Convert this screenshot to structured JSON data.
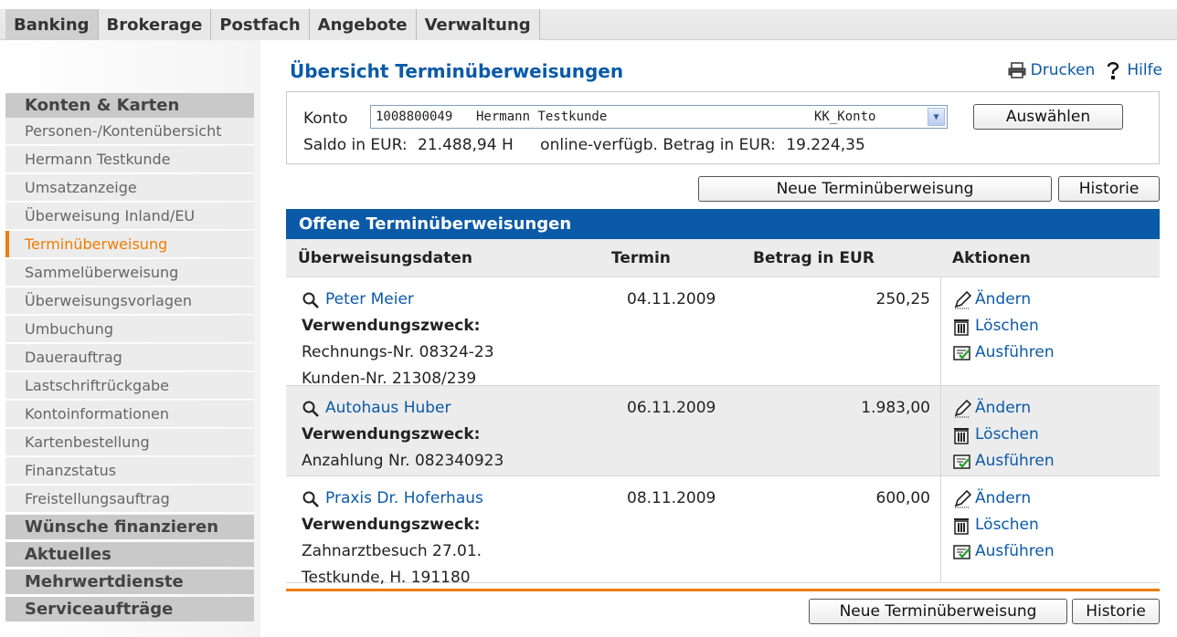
{
  "topnav": {
    "tabs": [
      {
        "label": "Banking"
      },
      {
        "label": "Brokerage"
      },
      {
        "label": "Postfach"
      },
      {
        "label": "Angebote"
      },
      {
        "label": "Verwaltung"
      }
    ]
  },
  "sidebar": {
    "section_konten": "Konten & Karten",
    "items": [
      "Personen-/Kontenübersicht",
      "Hermann Testkunde",
      "Umsatzanzeige",
      "Überweisung Inland/EU",
      "Terminüberweisung",
      "Sammelüberweisung",
      "Überweisungsvorlagen",
      "Umbuchung",
      "Dauerauftrag",
      "Lastschriftrückgabe",
      "Kontoinformationen",
      "Kartenbestellung",
      "Finanzstatus",
      "Freistellungsauftrag"
    ],
    "sections_bottom": [
      "Wünsche finanzieren",
      "Aktuelles",
      "Mehrwertdienste",
      "Serviceaufträge"
    ]
  },
  "main": {
    "title": "Übersicht Terminüberweisungen",
    "print_label": "Drucken",
    "help_label": "Hilfe",
    "account": {
      "label": "Konto",
      "selected_number": "1008800049",
      "selected_name": "Hermann Testkunde",
      "selected_type": "KK_Konto",
      "select_button": "Auswählen",
      "saldo_label": "Saldo in EUR:",
      "saldo_value": "21.488,94 H",
      "available_label": "online-verfügb. Betrag in EUR:",
      "available_value": "19.224,35"
    },
    "new_button": "Neue Terminüberweisung",
    "history_button": "Historie",
    "table": {
      "heading": "Offene Terminüberweisungen",
      "columns": [
        "Überweisungsdaten",
        "Termin",
        "Betrag in EUR",
        "Aktionen"
      ],
      "purpose_label": "Verwendungszweck:",
      "actions": {
        "edit": "Ändern",
        "delete": "Löschen",
        "execute": "Ausführen"
      },
      "rows": [
        {
          "name": "Peter Meier",
          "purpose_1": "Rechnungs-Nr. 08324-23",
          "purpose_2": "Kunden-Nr. 21308/239",
          "date": "04.11.2009",
          "amount": "250,25"
        },
        {
          "name": "Autohaus Huber",
          "purpose_1": "Anzahlung Nr. 082340923",
          "purpose_2": "",
          "date": "06.11.2009",
          "amount": "1.983,00"
        },
        {
          "name": "Praxis Dr. Hoferhaus",
          "purpose_1": "Zahnarztbesuch 27.01.",
          "purpose_2": "Testkunde, H. 191180",
          "date": "08.11.2009",
          "amount": "600,00"
        }
      ]
    }
  },
  "colors": {
    "brand_blue": "#0b5aa8",
    "accent_orange": "#f07d00",
    "nav_gray": "#c9c9c9"
  },
  "icons": {
    "print": "printer-icon",
    "help": "help-icon",
    "details": "magnifier-icon",
    "edit": "pencil-icon",
    "delete": "trash-icon",
    "execute": "execute-icon"
  }
}
